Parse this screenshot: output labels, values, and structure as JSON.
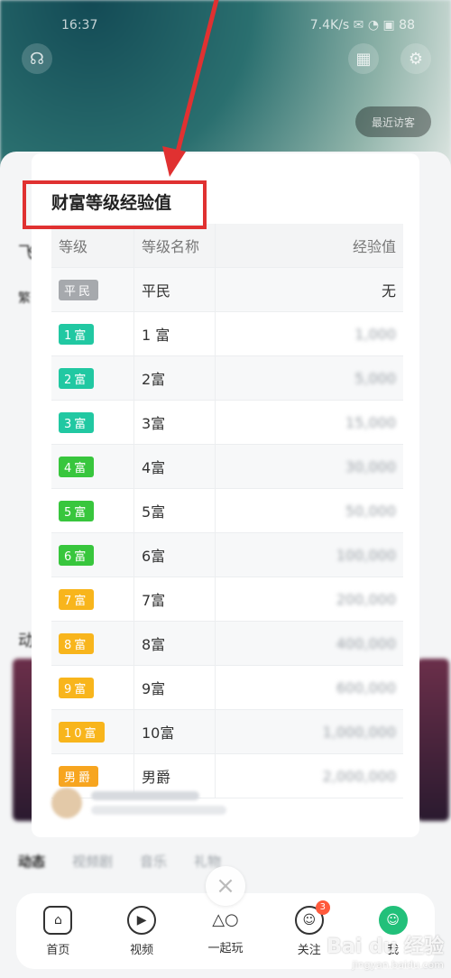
{
  "status": {
    "time": "16:37",
    "right": "7.4K/s ✉ ◔ ▣ 88"
  },
  "top_left_icon": "headset-icon",
  "top_right_icons": [
    "grid-icon",
    "settings-icon"
  ],
  "pill_label": "最近访客",
  "bg": {
    "label_1": "飞",
    "label_2": "繁",
    "label_3": "动"
  },
  "bg_tabs": [
    {
      "label": "动态",
      "active": true
    },
    {
      "label": "视频剧",
      "active": false
    },
    {
      "label": "音乐",
      "active": false
    },
    {
      "label": "礼物",
      "active": false
    }
  ],
  "modal": {
    "title": "财富等级经验值",
    "headers": {
      "level": "等级",
      "name": "等级名称",
      "exp": "经验值"
    },
    "rows": [
      {
        "badge": "平民",
        "badge_color": "#a6a9ad",
        "name": "平民",
        "exp": "无",
        "exp_blur": false
      },
      {
        "badge": "1富",
        "badge_color": "#21c8a2",
        "name": "1 富",
        "exp": "1,000",
        "exp_blur": true
      },
      {
        "badge": "2富",
        "badge_color": "#21c8a2",
        "name": "2富",
        "exp": "5,000",
        "exp_blur": true
      },
      {
        "badge": "3富",
        "badge_color": "#21c8a2",
        "name": "3富",
        "exp": "15,000",
        "exp_blur": true
      },
      {
        "badge": "4富",
        "badge_color": "#38c63d",
        "name": "4富",
        "exp": "30,000",
        "exp_blur": true
      },
      {
        "badge": "5富",
        "badge_color": "#38c63d",
        "name": "5富",
        "exp": "50,000",
        "exp_blur": true
      },
      {
        "badge": "6富",
        "badge_color": "#38c63d",
        "name": "6富",
        "exp": "100,000",
        "exp_blur": true
      },
      {
        "badge": "7富",
        "badge_color": "#f8b51c",
        "name": "7富",
        "exp": "200,000",
        "exp_blur": true
      },
      {
        "badge": "8富",
        "badge_color": "#f8b51c",
        "name": "8富",
        "exp": "400,000",
        "exp_blur": true
      },
      {
        "badge": "9富",
        "badge_color": "#f8b51c",
        "name": "9富",
        "exp": "600,000",
        "exp_blur": true
      },
      {
        "badge": "10富",
        "badge_color": "#f8b51c",
        "name": "10富",
        "exp": "1,000,000",
        "exp_blur": true
      },
      {
        "badge": "男爵",
        "badge_color": "#f7a51f",
        "name": "男爵",
        "exp": "2,000,000",
        "exp_blur": true
      }
    ]
  },
  "close_icon": "×",
  "nav": [
    {
      "label": "首页",
      "icon": "home-icon",
      "glyph": "⌂"
    },
    {
      "label": "视频",
      "icon": "play-icon",
      "glyph": "▶"
    },
    {
      "label": "一起玩",
      "icon": "shapes-icon",
      "glyph": "△○"
    },
    {
      "label": "关注",
      "icon": "smile-icon",
      "glyph": "☺",
      "badge": "3"
    },
    {
      "label": "我",
      "icon": "face-icon",
      "glyph": "☺"
    }
  ],
  "watermark": {
    "big": "Bai du 经验",
    "small": "jingyan.baidu.com"
  },
  "colors": {
    "highlight": "#e03131",
    "arrow": "#e03131"
  }
}
